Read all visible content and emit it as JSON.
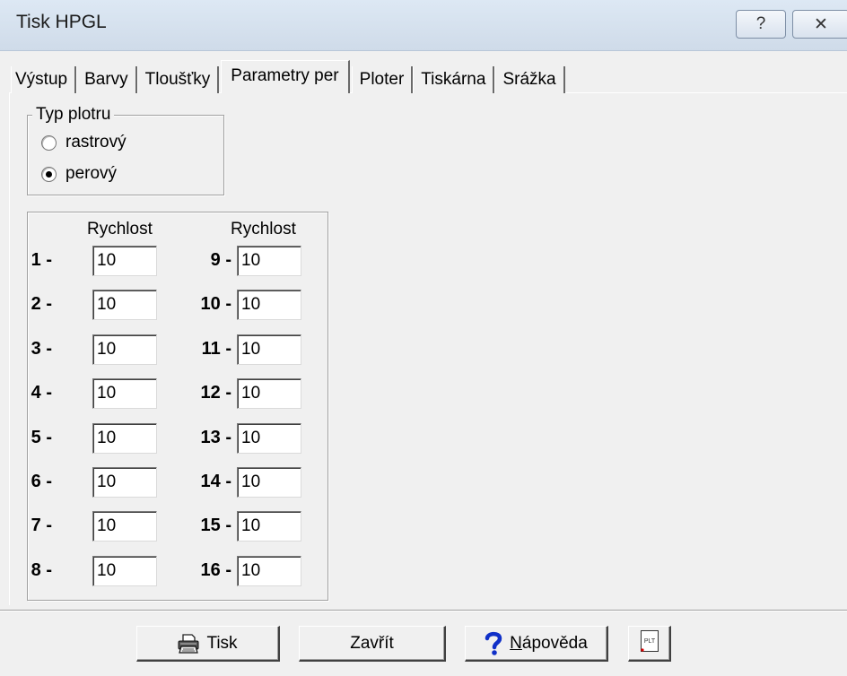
{
  "window": {
    "title": "Tisk HPGL",
    "help_glyph": "?",
    "close_glyph": "✕"
  },
  "tabs": [
    {
      "label": "Výstup"
    },
    {
      "label": "Barvy"
    },
    {
      "label": "Tloušťky"
    },
    {
      "label": "Parametry per",
      "active": true
    },
    {
      "label": "Ploter"
    },
    {
      "label": "Tiskárna"
    },
    {
      "label": "Srážka"
    }
  ],
  "plotter_type": {
    "legend": "Typ plotru",
    "options": [
      {
        "label": "rastrový",
        "selected": false
      },
      {
        "label": "perový",
        "selected": true
      }
    ]
  },
  "pens": {
    "header_left": "Rychlost",
    "header_right": "Rychlost",
    "left": [
      {
        "label": "1 -",
        "value": "10"
      },
      {
        "label": "2 -",
        "value": "10"
      },
      {
        "label": "3 -",
        "value": "10"
      },
      {
        "label": "4 -",
        "value": "10"
      },
      {
        "label": "5 -",
        "value": "10"
      },
      {
        "label": "6 -",
        "value": "10"
      },
      {
        "label": "7 -",
        "value": "10"
      },
      {
        "label": "8 -",
        "value": "10"
      }
    ],
    "right": [
      {
        "label": "9 -",
        "value": "10"
      },
      {
        "label": "10 -",
        "value": "10"
      },
      {
        "label": "11 -",
        "value": "10"
      },
      {
        "label": "12 -",
        "value": "10"
      },
      {
        "label": "13 -",
        "value": "10"
      },
      {
        "label": "14 -",
        "value": "10"
      },
      {
        "label": "15 -",
        "value": "10"
      },
      {
        "label": "16 -",
        "value": "10"
      }
    ]
  },
  "buttons": {
    "print": "Tisk",
    "close": "Zavřít",
    "help_underlined": "N",
    "help_rest": "ápověda",
    "plt_icon_text": "PLT"
  },
  "icons": {
    "print": "printer-icon",
    "help": "question-mark-icon",
    "plt": "plt-file-icon"
  }
}
